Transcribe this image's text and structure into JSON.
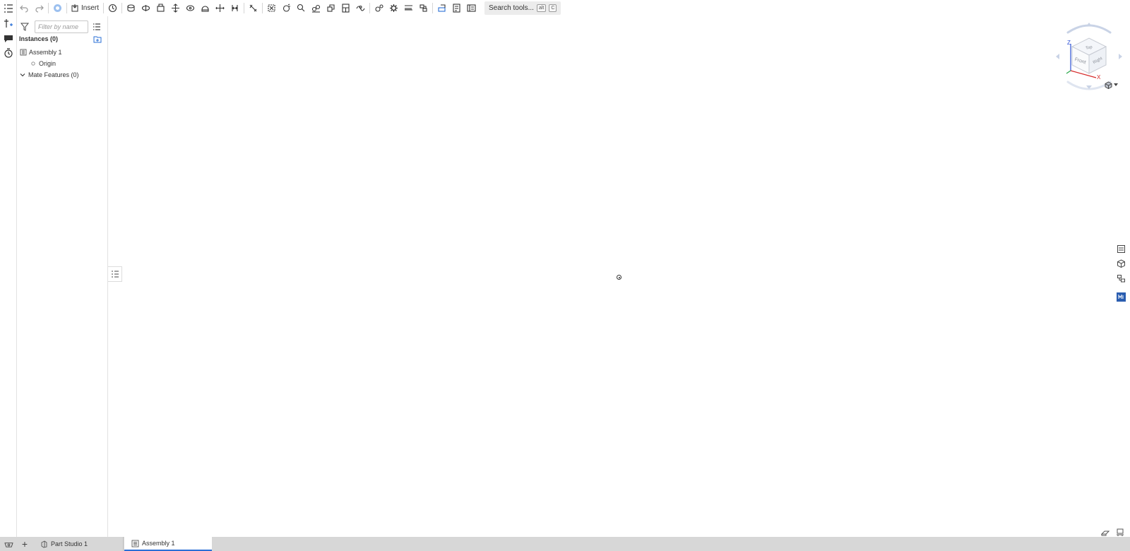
{
  "toolbar": {
    "insert_label": "Insert",
    "search_label": "Search tools...",
    "search_kbd_1": "alt",
    "search_kbd_2": "C"
  },
  "panel": {
    "filter_placeholder": "Filter by name",
    "instances_label": "Instances (0)",
    "tree": {
      "assembly_label": "Assembly 1",
      "origin_label": "Origin",
      "mate_features_label": "Mate Features (0)"
    }
  },
  "viewcube": {
    "top_label": "Top",
    "front_label": "Front",
    "right_label": "Right",
    "axis_z": "Z",
    "axis_x": "X"
  },
  "tabs": [
    {
      "label": "Part Studio 1",
      "active": false
    },
    {
      "label": "Assembly 1",
      "active": true
    }
  ],
  "colors": {
    "accent": "#2a6fd6",
    "tabbar_bg": "#d7d7d7",
    "axis_z": "#2a4fd6",
    "axis_x": "#d62a2a"
  }
}
